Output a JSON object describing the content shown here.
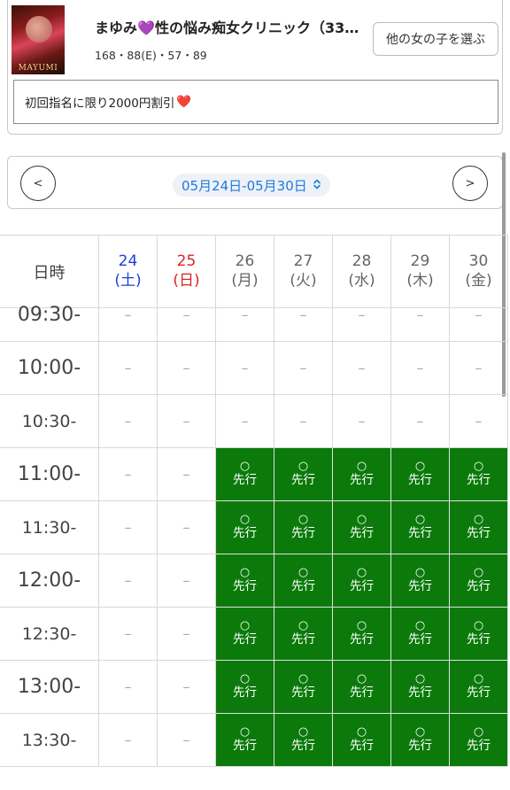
{
  "profile": {
    "photo_caption": "MAYUMI",
    "name_prefix": "まゆみ",
    "name_suffix": "性の悩み痴女クリニック（33…",
    "stats": "168・88(E)・57・89",
    "other_girls_button": "他の女の子を選ぶ",
    "promo_text": "初回指名に限り2000円割引",
    "promo_heart": "❤️"
  },
  "week_nav": {
    "prev_label": "<",
    "next_label": ">",
    "range_label": "05月24日-05月30日",
    "range_chevron": "⌃⌄"
  },
  "schedule": {
    "time_header": "日時",
    "days": [
      {
        "date": "24",
        "weekday": "(土)",
        "type": "sat"
      },
      {
        "date": "25",
        "weekday": "(日)",
        "type": "sun"
      },
      {
        "date": "26",
        "weekday": "(月)",
        "type": "weekday"
      },
      {
        "date": "27",
        "weekday": "(火)",
        "type": "weekday"
      },
      {
        "date": "28",
        "weekday": "(水)",
        "type": "weekday"
      },
      {
        "date": "29",
        "weekday": "(木)",
        "type": "weekday"
      },
      {
        "date": "30",
        "weekday": "(金)",
        "type": "weekday"
      }
    ],
    "unavailable_mark": "–",
    "open_mark": "○",
    "open_label": "先行",
    "rows": [
      {
        "time": "09:30-",
        "half": false,
        "cells": [
          "-",
          "-",
          "-",
          "-",
          "-",
          "-",
          "-"
        ]
      },
      {
        "time": "10:00-",
        "half": false,
        "cells": [
          "-",
          "-",
          "-",
          "-",
          "-",
          "-",
          "-"
        ]
      },
      {
        "time": "10:30-",
        "half": true,
        "cells": [
          "-",
          "-",
          "-",
          "-",
          "-",
          "-",
          "-"
        ]
      },
      {
        "time": "11:00-",
        "half": false,
        "cells": [
          "-",
          "-",
          "open",
          "open",
          "open",
          "open",
          "open"
        ]
      },
      {
        "time": "11:30-",
        "half": true,
        "cells": [
          "-",
          "-",
          "open",
          "open",
          "open",
          "open",
          "open"
        ]
      },
      {
        "time": "12:00-",
        "half": false,
        "cells": [
          "-",
          "-",
          "open",
          "open",
          "open",
          "open",
          "open"
        ]
      },
      {
        "time": "12:30-",
        "half": true,
        "cells": [
          "-",
          "-",
          "open",
          "open",
          "open",
          "open",
          "open"
        ]
      },
      {
        "time": "13:00-",
        "half": false,
        "cells": [
          "-",
          "-",
          "open",
          "open",
          "open",
          "open",
          "open"
        ]
      },
      {
        "time": "13:30-",
        "half": true,
        "cells": [
          "-",
          "-",
          "open",
          "open",
          "open",
          "open",
          "open"
        ]
      }
    ]
  },
  "colors": {
    "open_cell": "#0b7a0b",
    "saturday": "#1b3fd6",
    "sunday": "#e02222",
    "link": "#1f7ae0"
  }
}
